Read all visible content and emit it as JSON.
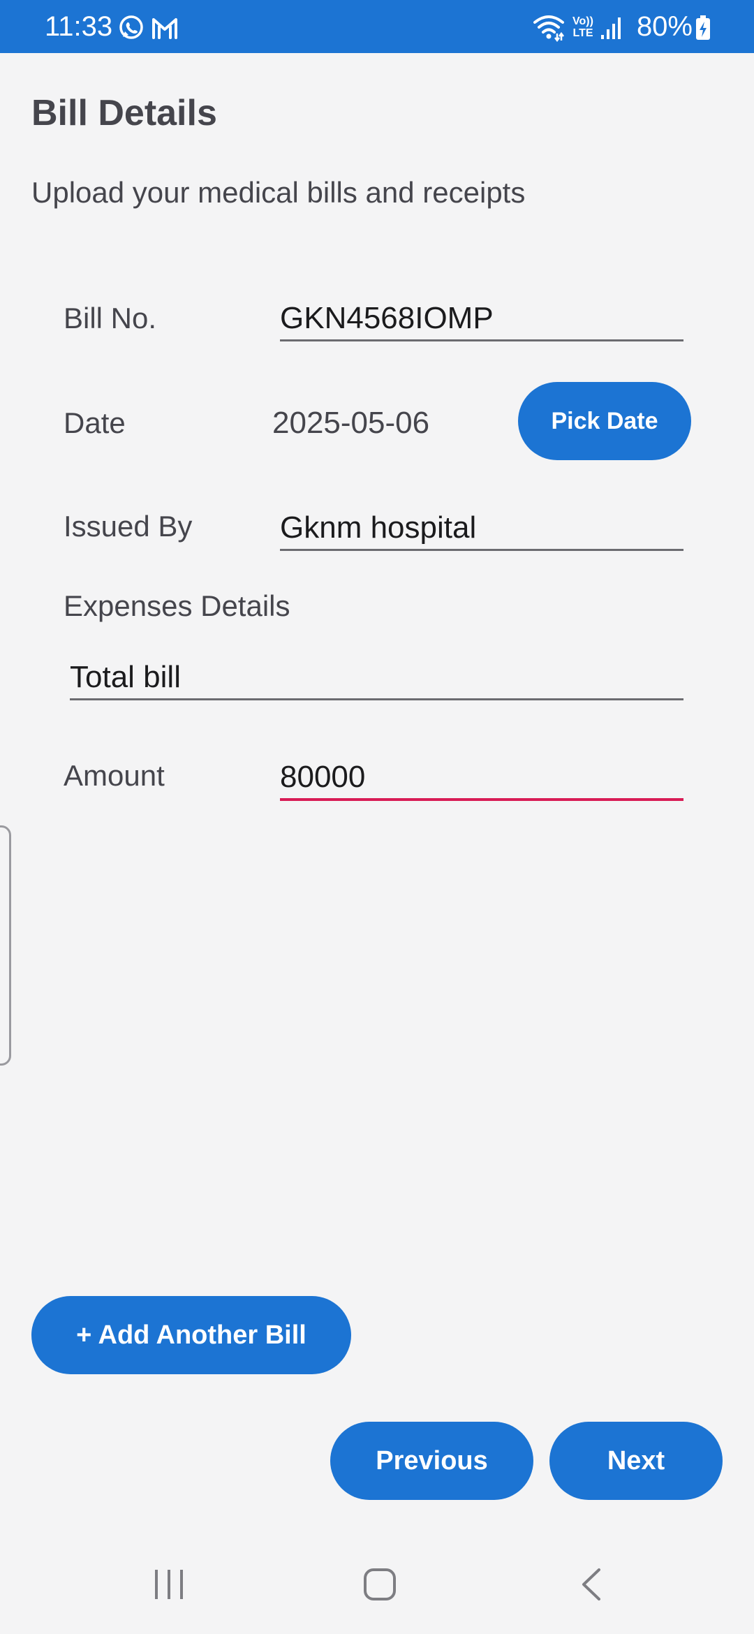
{
  "status_bar": {
    "time": "11:33",
    "battery": "80%",
    "color": "#1c74d3",
    "icons": [
      "whatsapp-icon",
      "gmail-icon",
      "wifi-icon",
      "volte-icon",
      "signal-icon",
      "battery-charging-icon"
    ],
    "volte_top": "Vo))",
    "volte_bottom": "LTE"
  },
  "header": {
    "title": "Bill Details",
    "subtitle": "Upload your medical bills and receipts"
  },
  "form": {
    "bill_no": {
      "label": "Bill No.",
      "value": "GKN4568IOMP"
    },
    "date": {
      "label": "Date",
      "value": "2025-05-06",
      "button": "Pick Date"
    },
    "issued_by": {
      "label": "Issued By",
      "value": "Gknm hospital"
    },
    "expenses": {
      "label": "Expenses Details",
      "value": "Total bill"
    },
    "amount": {
      "label": "Amount",
      "value": "80000"
    }
  },
  "actions": {
    "add_bill": "+ Add Another Bill",
    "previous": "Previous",
    "next": "Next"
  },
  "colors": {
    "accent": "#1c74d3",
    "focus_underline": "#d81b55",
    "background": "#f4f4f5",
    "text": "#45454c"
  },
  "nav_bar": {
    "icons": [
      "recent-apps-icon",
      "home-icon",
      "back-icon"
    ]
  }
}
